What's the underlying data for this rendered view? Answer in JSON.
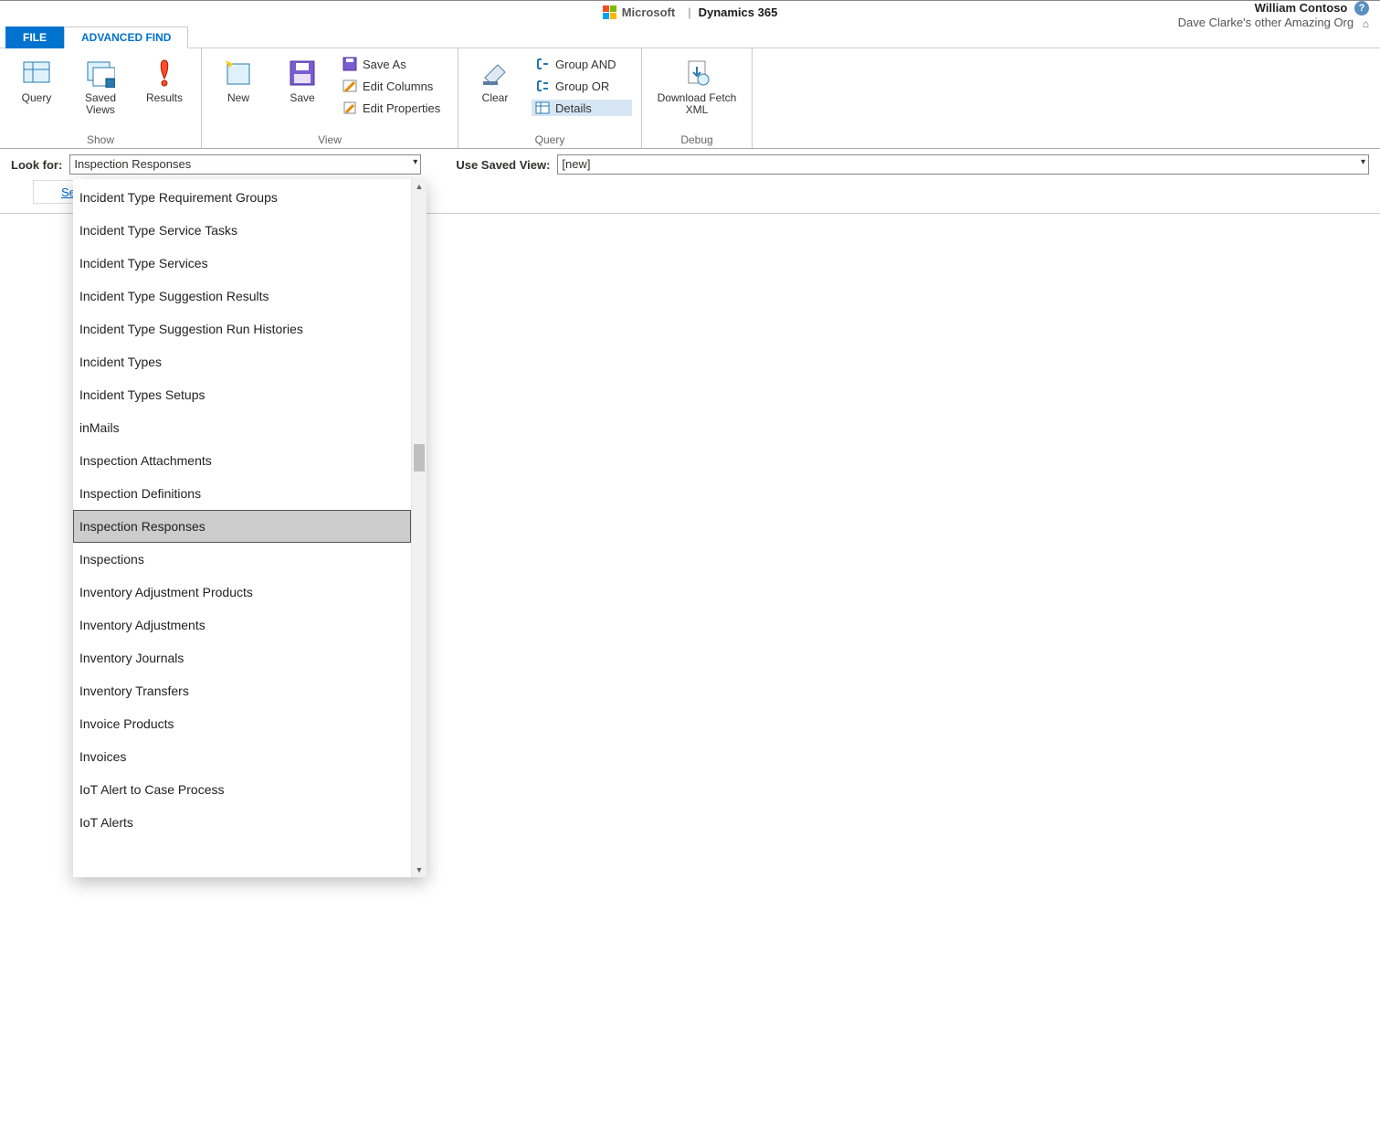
{
  "header": {
    "ms_label": "Microsoft",
    "product": "Dynamics 365",
    "user": "William Contoso",
    "org": "Dave Clarke's other Amazing Org"
  },
  "tabs": {
    "file": "FILE",
    "advanced_find": "ADVANCED FIND"
  },
  "ribbon": {
    "show": {
      "caption": "Show",
      "query": "Query",
      "saved_views": "Saved Views",
      "results": "Results"
    },
    "view": {
      "caption": "View",
      "new": "New",
      "save": "Save",
      "save_as": "Save As",
      "edit_columns": "Edit Columns",
      "edit_properties": "Edit Properties"
    },
    "query": {
      "caption": "Query",
      "clear": "Clear",
      "group_and": "Group AND",
      "group_or": "Group OR",
      "details": "Details"
    },
    "debug": {
      "caption": "Debug",
      "download_fetch_xml": "Download Fetch XML"
    }
  },
  "form": {
    "look_for_label": "Look for:",
    "look_for_value": "Inspection Responses",
    "saved_view_label": "Use Saved View:",
    "saved_view_value": "[new]",
    "select_link": "Sele"
  },
  "dropdown": {
    "selected_index": 10,
    "items": [
      "Incident Type Requirement Groups",
      "Incident Type Service Tasks",
      "Incident Type Services",
      "Incident Type Suggestion Results",
      "Incident Type Suggestion Run Histories",
      "Incident Types",
      "Incident Types Setups",
      "inMails",
      "Inspection Attachments",
      "Inspection Definitions",
      "Inspection Responses",
      "Inspections",
      "Inventory Adjustment Products",
      "Inventory Adjustments",
      "Inventory Journals",
      "Inventory Transfers",
      "Invoice Products",
      "Invoices",
      "IoT Alert to Case Process",
      "IoT Alerts"
    ]
  }
}
